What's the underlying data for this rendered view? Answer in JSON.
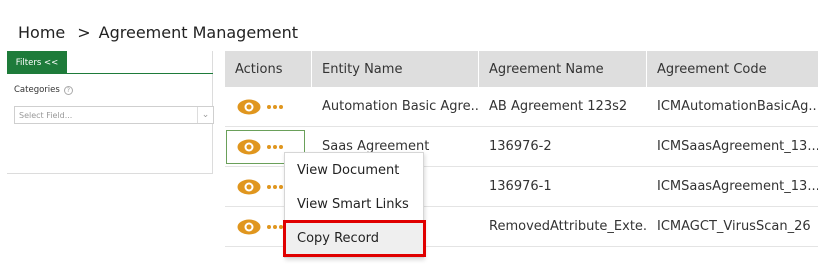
{
  "breadcrumb": {
    "home": "Home",
    "separator": ">",
    "current": "Agreement Management"
  },
  "filters": {
    "button_label": "Filters <<",
    "categories_label": "Categories",
    "help_glyph": "?",
    "select_placeholder": "Select Field...",
    "chevron_glyph": "⌄"
  },
  "table": {
    "headers": [
      "Actions",
      "Entity Name",
      "Agreement Name",
      "Agreement Code"
    ],
    "rows": [
      {
        "entity": "Automation Basic Agre...",
        "agreement": "AB Agreement 123s2",
        "code": "ICMAutomationBasicAg..."
      },
      {
        "entity": "Saas Agreement",
        "agreement": "136976-2",
        "code": "ICMSaasAgreement_13..."
      },
      {
        "entity": "",
        "agreement": "136976-1",
        "code": "ICMSaasAgreement_13..."
      },
      {
        "entity": "",
        "agreement": "RemovedAttribute_Exte...",
        "code": "ICMAGCT_VirusScan_26"
      }
    ]
  },
  "context_menu": {
    "items": [
      "View Document",
      "View Smart Links",
      "Copy Record"
    ],
    "highlighted_index": 2,
    "highlight_color": "#e00000"
  },
  "colors": {
    "accent_green": "#1e7b3a",
    "icon_orange": "#e0961e"
  },
  "icons": {
    "view": "eye-icon",
    "more": "more-dots-icon"
  }
}
